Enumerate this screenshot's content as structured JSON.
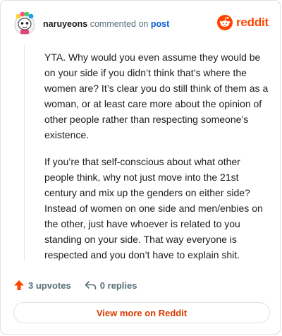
{
  "header": {
    "username": "naruyeons",
    "action_text": "commented on",
    "post_link": "post",
    "logo_text": "reddit"
  },
  "comment": {
    "paragraphs": [
      "YTA. Why would you even assume they would be on your side if you didn’t think that’s where the women are? It’s clear you do still think of them as a woman, or at least care more about the opinion of other people rather than respecting someone’s existence.",
      "If you’re that self-conscious about what other people think, why not just move into the 21st century and mix up the genders on either side? Instead of women on one side and men/enbies on the other, just have whoever is related to you standing on your side. That way everyone is respected and you don’t have to explain shit."
    ]
  },
  "actions": {
    "upvotes": "3 upvotes",
    "replies": "0 replies"
  },
  "footer": {
    "view_more_label": "View more on Reddit"
  },
  "colors": {
    "brand": "#ff4500",
    "link": "#0a5bd6",
    "view_more": "#d93a00",
    "muted": "#576f76"
  },
  "icons": {
    "avatar": "avatar-icon",
    "logo": "reddit-logo-icon",
    "upvote": "upvote-arrow-icon",
    "reply": "reply-arrow-icon"
  }
}
